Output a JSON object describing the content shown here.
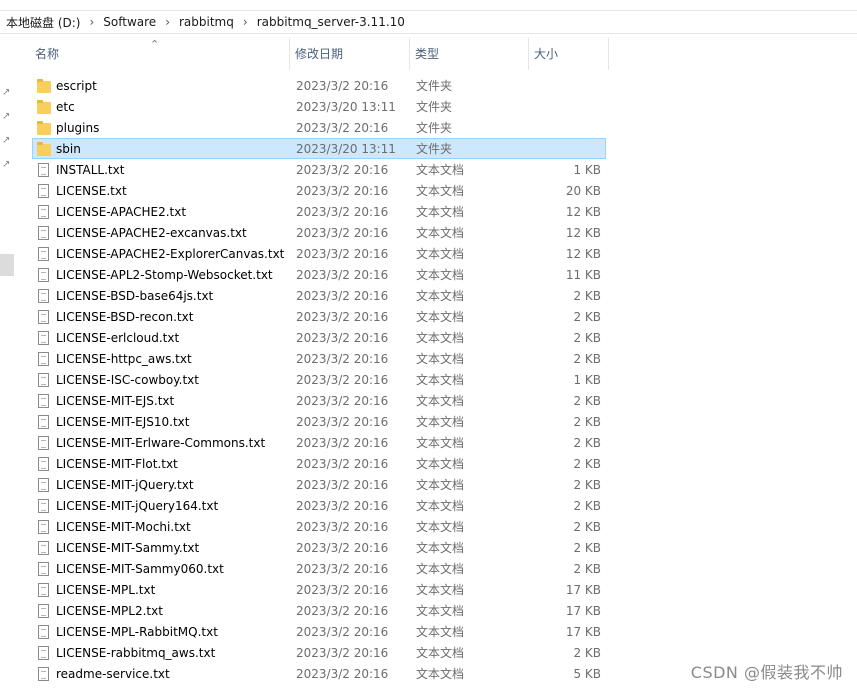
{
  "breadcrumb": [
    "本地磁盘 (D:)",
    "Software",
    "rabbitmq",
    "rabbitmq_server-3.11.10"
  ],
  "columns": {
    "name": "名称",
    "date": "修改日期",
    "type": "类型",
    "size": "大小"
  },
  "files": [
    {
      "name": "escript",
      "date": "2023/3/2 20:16",
      "type": "文件夹",
      "size": "",
      "kind": "folder",
      "selected": false
    },
    {
      "name": "etc",
      "date": "2023/3/20 13:11",
      "type": "文件夹",
      "size": "",
      "kind": "folder",
      "selected": false
    },
    {
      "name": "plugins",
      "date": "2023/3/2 20:16",
      "type": "文件夹",
      "size": "",
      "kind": "folder",
      "selected": false
    },
    {
      "name": "sbin",
      "date": "2023/3/20 13:11",
      "type": "文件夹",
      "size": "",
      "kind": "folder",
      "selected": true
    },
    {
      "name": "INSTALL.txt",
      "date": "2023/3/2 20:16",
      "type": "文本文档",
      "size": "1 KB",
      "kind": "file",
      "selected": false
    },
    {
      "name": "LICENSE.txt",
      "date": "2023/3/2 20:16",
      "type": "文本文档",
      "size": "20 KB",
      "kind": "file",
      "selected": false
    },
    {
      "name": "LICENSE-APACHE2.txt",
      "date": "2023/3/2 20:16",
      "type": "文本文档",
      "size": "12 KB",
      "kind": "file",
      "selected": false
    },
    {
      "name": "LICENSE-APACHE2-excanvas.txt",
      "date": "2023/3/2 20:16",
      "type": "文本文档",
      "size": "12 KB",
      "kind": "file",
      "selected": false
    },
    {
      "name": "LICENSE-APACHE2-ExplorerCanvas.txt",
      "date": "2023/3/2 20:16",
      "type": "文本文档",
      "size": "12 KB",
      "kind": "file",
      "selected": false
    },
    {
      "name": "LICENSE-APL2-Stomp-Websocket.txt",
      "date": "2023/3/2 20:16",
      "type": "文本文档",
      "size": "11 KB",
      "kind": "file",
      "selected": false
    },
    {
      "name": "LICENSE-BSD-base64js.txt",
      "date": "2023/3/2 20:16",
      "type": "文本文档",
      "size": "2 KB",
      "kind": "file",
      "selected": false
    },
    {
      "name": "LICENSE-BSD-recon.txt",
      "date": "2023/3/2 20:16",
      "type": "文本文档",
      "size": "2 KB",
      "kind": "file",
      "selected": false
    },
    {
      "name": "LICENSE-erlcloud.txt",
      "date": "2023/3/2 20:16",
      "type": "文本文档",
      "size": "2 KB",
      "kind": "file",
      "selected": false
    },
    {
      "name": "LICENSE-httpc_aws.txt",
      "date": "2023/3/2 20:16",
      "type": "文本文档",
      "size": "2 KB",
      "kind": "file",
      "selected": false
    },
    {
      "name": "LICENSE-ISC-cowboy.txt",
      "date": "2023/3/2 20:16",
      "type": "文本文档",
      "size": "1 KB",
      "kind": "file",
      "selected": false
    },
    {
      "name": "LICENSE-MIT-EJS.txt",
      "date": "2023/3/2 20:16",
      "type": "文本文档",
      "size": "2 KB",
      "kind": "file",
      "selected": false
    },
    {
      "name": "LICENSE-MIT-EJS10.txt",
      "date": "2023/3/2 20:16",
      "type": "文本文档",
      "size": "2 KB",
      "kind": "file",
      "selected": false
    },
    {
      "name": "LICENSE-MIT-Erlware-Commons.txt",
      "date": "2023/3/2 20:16",
      "type": "文本文档",
      "size": "2 KB",
      "kind": "file",
      "selected": false
    },
    {
      "name": "LICENSE-MIT-Flot.txt",
      "date": "2023/3/2 20:16",
      "type": "文本文档",
      "size": "2 KB",
      "kind": "file",
      "selected": false
    },
    {
      "name": "LICENSE-MIT-jQuery.txt",
      "date": "2023/3/2 20:16",
      "type": "文本文档",
      "size": "2 KB",
      "kind": "file",
      "selected": false
    },
    {
      "name": "LICENSE-MIT-jQuery164.txt",
      "date": "2023/3/2 20:16",
      "type": "文本文档",
      "size": "2 KB",
      "kind": "file",
      "selected": false
    },
    {
      "name": "LICENSE-MIT-Mochi.txt",
      "date": "2023/3/2 20:16",
      "type": "文本文档",
      "size": "2 KB",
      "kind": "file",
      "selected": false
    },
    {
      "name": "LICENSE-MIT-Sammy.txt",
      "date": "2023/3/2 20:16",
      "type": "文本文档",
      "size": "2 KB",
      "kind": "file",
      "selected": false
    },
    {
      "name": "LICENSE-MIT-Sammy060.txt",
      "date": "2023/3/2 20:16",
      "type": "文本文档",
      "size": "2 KB",
      "kind": "file",
      "selected": false
    },
    {
      "name": "LICENSE-MPL.txt",
      "date": "2023/3/2 20:16",
      "type": "文本文档",
      "size": "17 KB",
      "kind": "file",
      "selected": false
    },
    {
      "name": "LICENSE-MPL2.txt",
      "date": "2023/3/2 20:16",
      "type": "文本文档",
      "size": "17 KB",
      "kind": "file",
      "selected": false
    },
    {
      "name": "LICENSE-MPL-RabbitMQ.txt",
      "date": "2023/3/2 20:16",
      "type": "文本文档",
      "size": "17 KB",
      "kind": "file",
      "selected": false
    },
    {
      "name": "LICENSE-rabbitmq_aws.txt",
      "date": "2023/3/2 20:16",
      "type": "文本文档",
      "size": "2 KB",
      "kind": "file",
      "selected": false
    },
    {
      "name": "readme-service.txt",
      "date": "2023/3/2 20:16",
      "type": "文本文档",
      "size": "5 KB",
      "kind": "file",
      "selected": false
    }
  ],
  "watermark": "CSDN @假装我不帅",
  "colors": {
    "selected_bg": "#cce8ff",
    "selected_border": "#99d1ff",
    "header_text": "#4c607a",
    "folder": "#f8cf5f"
  }
}
